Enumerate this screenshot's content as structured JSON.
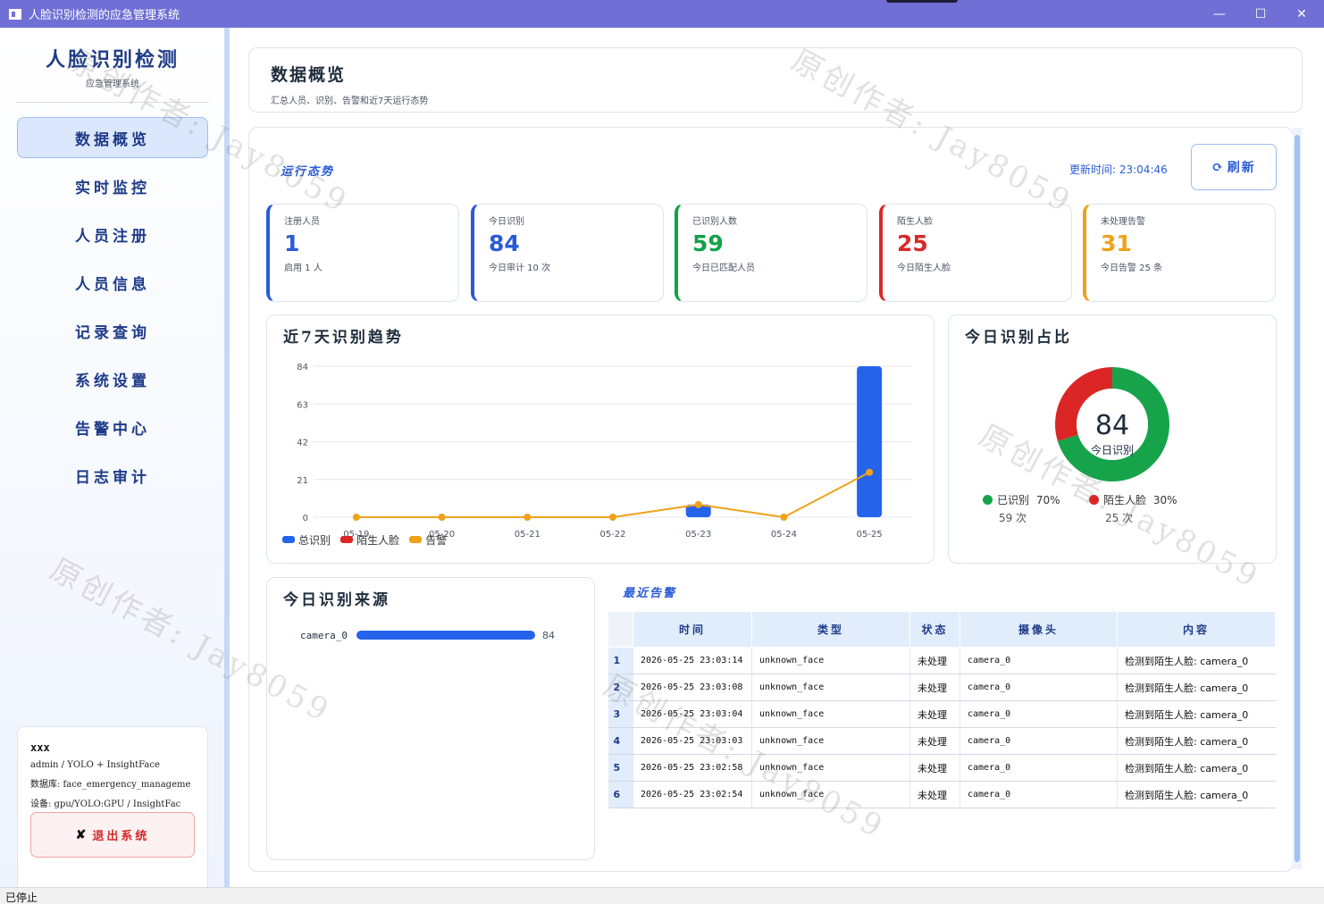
{
  "window": {
    "title": "人脸识别检测的应急管理系统",
    "minimize": "—",
    "maximize": "☐",
    "close": "✕"
  },
  "sidebar": {
    "brand_title": "人脸识别检测",
    "brand_sub": "应急管理系统",
    "items": [
      {
        "label": "数据概览",
        "active": true
      },
      {
        "label": "实时监控"
      },
      {
        "label": "人员注册"
      },
      {
        "label": "人员信息"
      },
      {
        "label": "记录查询"
      },
      {
        "label": "系统设置"
      },
      {
        "label": "告警中心"
      },
      {
        "label": "日志审计"
      }
    ],
    "user": {
      "name": "xxx",
      "role": "admin / YOLO + InsightFace",
      "db": "数据库: face_emergency_manageme",
      "device": "设备: gpu/YOLO:GPU / InsightFac"
    },
    "logout_icon": "✘",
    "logout_label": "退出系统"
  },
  "header": {
    "title": "数据概览",
    "subtitle": "汇总人员、识别、告警和近7天运行态势"
  },
  "overview": {
    "section_label": "运行态势",
    "update_time": "更新时间: 23:04:46",
    "refresh_icon": "⟳",
    "refresh_label": "刷新",
    "stats": [
      {
        "label": "注册人员",
        "value": "1",
        "sub": "启用 1 人",
        "color": "#2a5bd7"
      },
      {
        "label": "今日识别",
        "value": "84",
        "sub": "今日审计 10 次",
        "color": "#2a5bd7"
      },
      {
        "label": "已识别人数",
        "value": "59",
        "sub": "今日已匹配人员",
        "color": "#15a04a"
      },
      {
        "label": "陌生人脸",
        "value": "25",
        "sub": "今日陌生人脸",
        "color": "#d92a2a"
      },
      {
        "label": "未处理告警",
        "value": "31",
        "sub": "今日告警 25 条",
        "color": "#f0a11a"
      }
    ]
  },
  "trend": {
    "title": "近7天识别趋势",
    "legend": [
      "总识别",
      "陌生人脸",
      "告警"
    ]
  },
  "chart_data": [
    {
      "type": "bar",
      "title": "近7天识别趋势",
      "categories": [
        "05-19",
        "05-20",
        "05-21",
        "05-22",
        "05-23",
        "05-24",
        "05-25"
      ],
      "y_ticks": [
        0,
        21,
        42,
        63,
        84
      ],
      "ylim": [
        0,
        84
      ],
      "series": [
        {
          "name": "总识别",
          "type": "bar",
          "color": "#2563eb",
          "values": [
            0,
            0,
            0,
            0,
            7,
            0,
            84
          ]
        },
        {
          "name": "陌生人脸",
          "type": "bar",
          "color": "#dc2626",
          "values": [
            0,
            0,
            0,
            0,
            0,
            0,
            0
          ]
        },
        {
          "name": "告警",
          "type": "line",
          "color": "#f0a11a",
          "values": [
            0,
            0,
            0,
            0,
            7,
            0,
            25
          ]
        }
      ],
      "legend_position": "bottom-left"
    },
    {
      "type": "pie",
      "title": "今日识别占比",
      "center_value": "84",
      "center_label": "今日识别",
      "slices": [
        {
          "name": "已识别",
          "percent_label": "70%",
          "count_label": "59 次",
          "value": 59,
          "color": "#16a34a"
        },
        {
          "name": "陌生人脸",
          "percent_label": "30%",
          "count_label": "25 次",
          "value": 25,
          "color": "#dc2626"
        }
      ]
    },
    {
      "type": "bar",
      "title": "今日识别来源",
      "categories": [
        "camera_0"
      ],
      "values": [
        84
      ],
      "xlim": [
        0,
        84
      ],
      "color": "#2563eb"
    }
  ],
  "alerts": {
    "section_label": "最近告警",
    "columns": [
      "时间",
      "类型",
      "状态",
      "摄像头",
      "内容"
    ],
    "rows": [
      [
        "1",
        "2026-05-25 23:03:14",
        "unknown_face",
        "未处理",
        "camera_0",
        "检测到陌生人脸: camera_0"
      ],
      [
        "2",
        "2026-05-25 23:03:08",
        "unknown_face",
        "未处理",
        "camera_0",
        "检测到陌生人脸: camera_0"
      ],
      [
        "3",
        "2026-05-25 23:03:04",
        "unknown_face",
        "未处理",
        "camera_0",
        "检测到陌生人脸: camera_0"
      ],
      [
        "4",
        "2026-05-25 23:03:03",
        "unknown_face",
        "未处理",
        "camera_0",
        "检测到陌生人脸: camera_0"
      ],
      [
        "5",
        "2026-05-25 23:02:58",
        "unknown_face",
        "未处理",
        "camera_0",
        "检测到陌生人脸: camera_0"
      ],
      [
        "6",
        "2026-05-25 23:02:54",
        "unknown_face",
        "未处理",
        "camera_0",
        "检测到陌生人脸: camera_0"
      ]
    ]
  },
  "statusbar": {
    "text": "已停止"
  },
  "watermark": {
    "text": "原创作者: Jay8059"
  }
}
